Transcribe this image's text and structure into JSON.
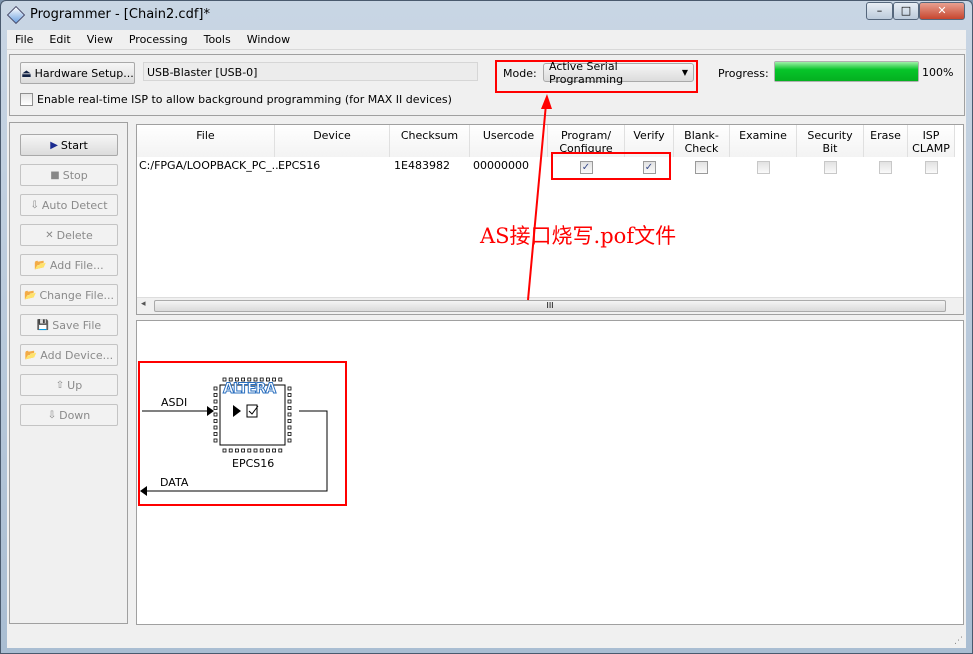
{
  "window": {
    "title": "Programmer - [Chain2.cdf]*",
    "minimize": "–",
    "maximize": "□",
    "close": "✕"
  },
  "menu": [
    "File",
    "Edit",
    "View",
    "Processing",
    "Tools",
    "Window"
  ],
  "toolbar": {
    "hardware_setup": "Hardware Setup...",
    "hardware_value": "USB-Blaster [USB-0]",
    "isp_checkbox": "Enable real-time ISP to allow background programming (for MAX II devices)",
    "isp_checked": false,
    "mode_label": "Mode:",
    "mode_value": "Active Serial Programming",
    "progress_label": "Progress:",
    "progress_value": "100%",
    "progress_percent": 100,
    "progress_color": "#06c52a"
  },
  "buttons": [
    {
      "label": "Start",
      "enabled": true
    },
    {
      "label": "Stop",
      "enabled": false
    },
    {
      "label": "Auto Detect",
      "enabled": false
    },
    {
      "label": "Delete",
      "enabled": false
    },
    {
      "label": "Add File...",
      "enabled": false
    },
    {
      "label": "Change File...",
      "enabled": false
    },
    {
      "label": "Save File",
      "enabled": false
    },
    {
      "label": "Add Device...",
      "enabled": false
    },
    {
      "label": "Up",
      "enabled": false
    },
    {
      "label": "Down",
      "enabled": false
    }
  ],
  "table": {
    "columns": [
      "File",
      "Device",
      "Checksum",
      "Usercode",
      "Program/\nConfigure",
      "Verify",
      "Blank-\nCheck",
      "Examine",
      "Security\nBit",
      "Erase",
      "ISP\nCLAMP"
    ],
    "rows": [
      {
        "file": "C:/FPGA/LOOPBACK_PC_...",
        "device": "EPCS16",
        "checksum": "1E483982",
        "usercode": "00000000",
        "program": true,
        "verify": true,
        "blank_check": false,
        "examine": false,
        "security_bit": false,
        "erase": false,
        "isp_clamp": false
      }
    ]
  },
  "diagram": {
    "input_label": "ASDI",
    "output_label": "DATA",
    "device_label": "EPCS16",
    "logo": "ALTERA"
  },
  "annotation": {
    "text": "AS接口烧写.pof文件",
    "color": "#ff0000"
  }
}
